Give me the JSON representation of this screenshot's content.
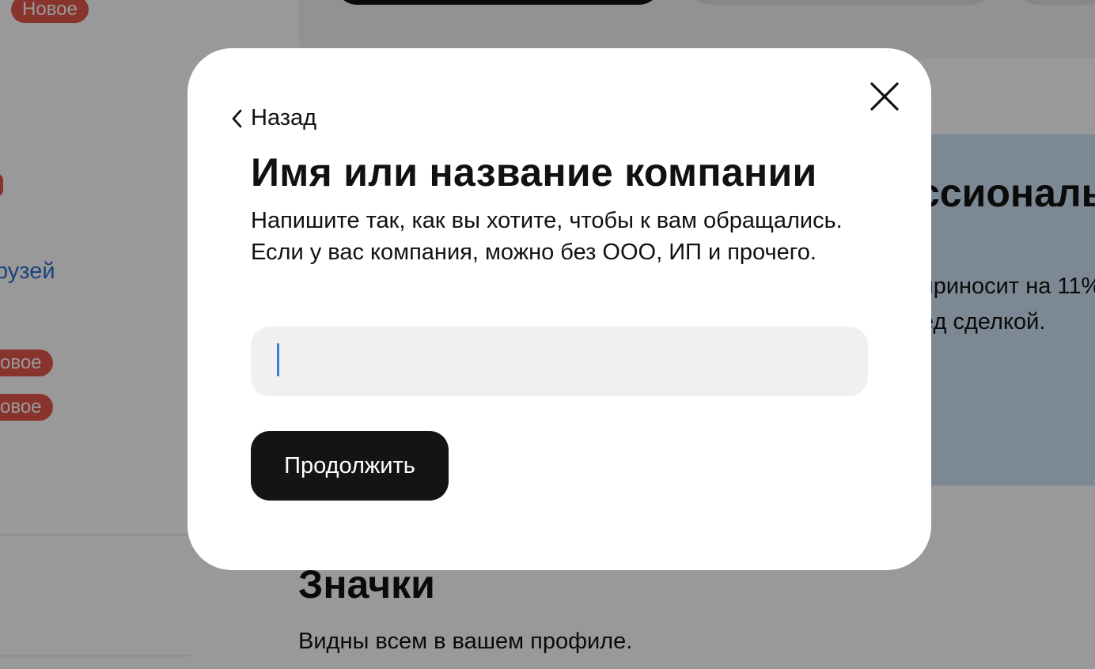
{
  "background": {
    "badges": [
      "Новое",
      "овое",
      "овое"
    ],
    "friends_link": "рузей",
    "promo": {
      "title": "ссионалы",
      "line1": "приносит на 11%",
      "line2": "ед сделкой."
    },
    "section": {
      "title": "Значки",
      "subtitle": "Видны всем в вашем профиле."
    },
    "colors": {
      "badge": "#e4564c",
      "link": "#2f6fd0",
      "promo_bg": "#cfe3f7"
    }
  },
  "modal": {
    "back_label": "Назад",
    "title": "Имя или название компании",
    "description": "Напишите так, как вы хотите, чтобы к вам обращались. Если у вас компания, можно без ООО, ИП и прочего.",
    "input": {
      "value": "",
      "placeholder": ""
    },
    "continue_label": "Продолжить",
    "icons": {
      "close": "close-icon",
      "back": "chevron-left-icon"
    },
    "colors": {
      "button_bg": "#141414",
      "input_bg": "#f1f0ee",
      "caret": "#3a7be0"
    }
  }
}
